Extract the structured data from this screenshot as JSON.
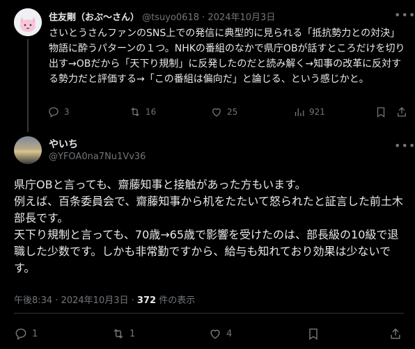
{
  "reply": {
    "author_name": "住友剛（おぶ〜さん）",
    "handle": "@tsuyo0618",
    "separator": "·",
    "date": "2024年10月3日",
    "body": "さいとうさんファンのSNS上での発信に典型的に見られる「抵抗勢力との対決」物語に酔うパターンの１つ。NHKの番組のなかで県庁OBが話すところだけを切り出す→OBだから「天下り規制」に反発したのだと読み解く→知事の改革に反対する勢力だと評価する→「この番組は偏向だ」と論じる、という感じかと。",
    "stats": {
      "replies": "3",
      "reposts": "16",
      "likes": "25",
      "views": "921"
    }
  },
  "tweet": {
    "author_name": "やいち",
    "handle": "@YFOA0na7Nu1Vv36",
    "paragraphs": [
      "県庁OBと言っても、齋藤知事と接触があった方もいます。",
      "例えば、百条委員会で、齋藤知事から机をたたいて怒られたと証言した前土木部長です。",
      "天下り規制と言っても、70歳→65歳で影響を受けたのは、部長級の10級で退職した少数です。しかも非常勤ですから、給与も知れており効果は少ないです。"
    ],
    "time": "午後8:34 · 2024年10月3日 ·",
    "view_count": "372",
    "view_label": "件の表示",
    "stats": {
      "replies": "1",
      "reposts": "1",
      "likes": "4"
    }
  }
}
